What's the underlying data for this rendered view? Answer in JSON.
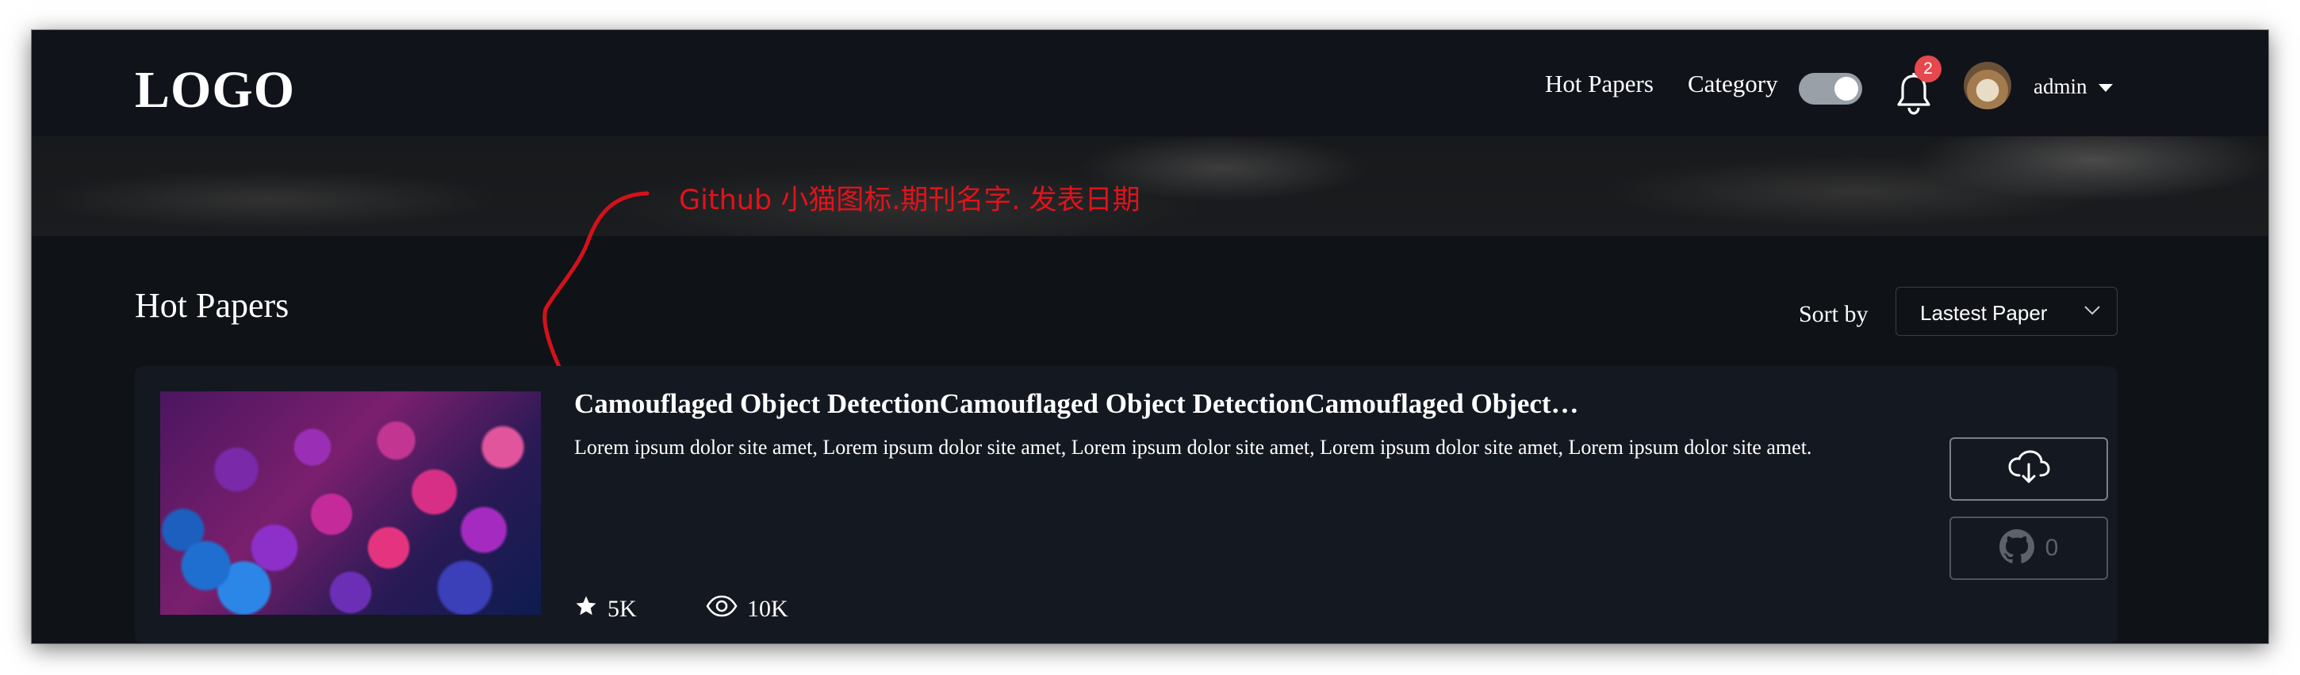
{
  "header": {
    "logo": "LOGO",
    "nav": {
      "hot_papers": "Hot Papers",
      "category": "Category"
    },
    "category_toggle_on": true,
    "notification_count": "2",
    "user": {
      "name": "admin"
    }
  },
  "annotation": {
    "text": "Github 小猫图标.期刊名字. 发表日期",
    "color": "#e0131b"
  },
  "section": {
    "title": "Hot Papers",
    "sort_label": "Sort by",
    "sort_value": "Lastest Paper"
  },
  "papers": [
    {
      "title": "Camouflaged Object DetectionCamouflaged Object DetectionCamouflaged Object…",
      "description": "Lorem ipsum dolor site amet, Lorem ipsum dolor site amet, Lorem ipsum dolor site amet, Lorem ipsum dolor site amet, Lorem ipsum dolor site amet.",
      "stars": "5K",
      "views": "10K",
      "github_count": "0"
    }
  ],
  "icons": {
    "bell": "bell-icon",
    "star": "star-icon",
    "eye": "eye-icon",
    "download": "cloud-download-icon",
    "github": "github-icon",
    "caret": "caret-down-icon",
    "chevron": "chevron-down-icon"
  }
}
